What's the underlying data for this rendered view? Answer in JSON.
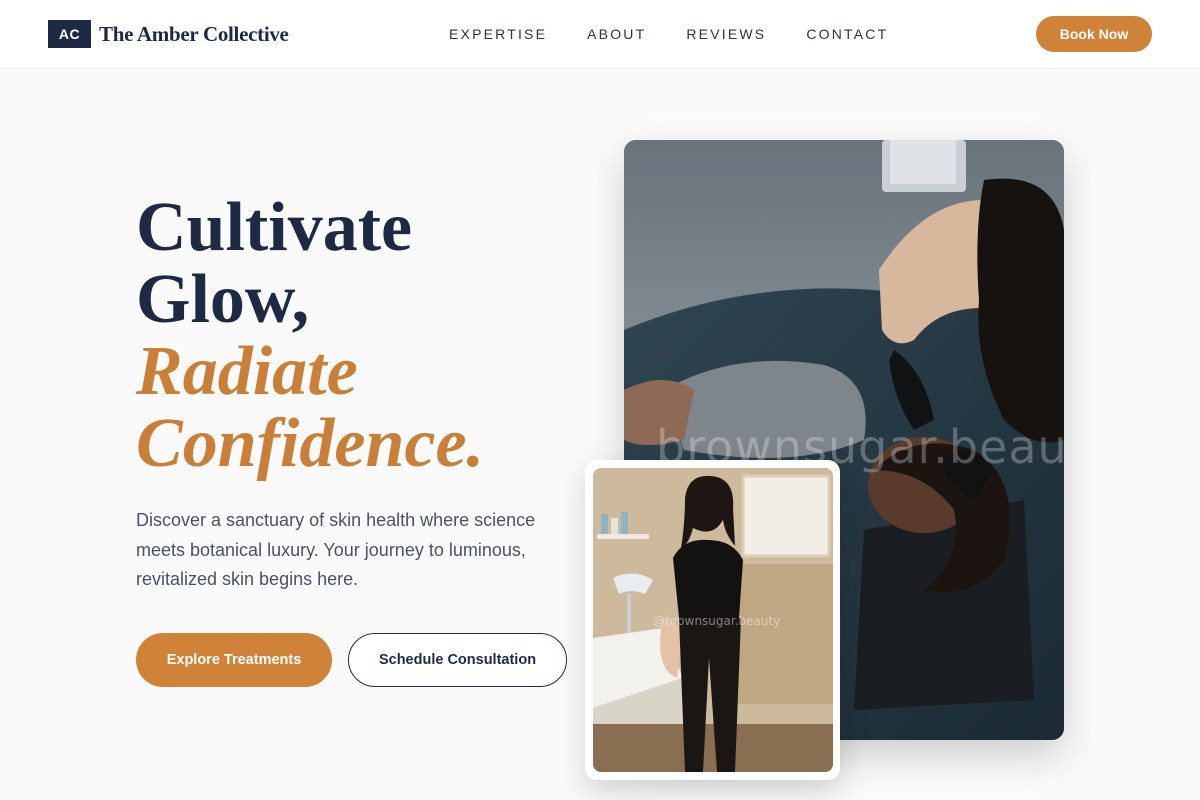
{
  "brand": {
    "mark": "AC",
    "name": "The Amber Collective"
  },
  "nav": {
    "items": [
      "EXPERTISE",
      "ABOUT",
      "REVIEWS",
      "CONTACT"
    ]
  },
  "header": {
    "cta_label": "Book Now"
  },
  "hero": {
    "headline_line1": "Cultivate",
    "headline_line2": "Glow,",
    "headline_accent_line1": "Radiate",
    "headline_accent_line2": "Confidence.",
    "description": "Discover a sanctuary of skin health where science meets botanical luxury. Your journey to luminous, revitalized skin begins here.",
    "primary_cta": "Explore Treatments",
    "secondary_cta": "Schedule Consultation"
  },
  "images": {
    "main_watermark": "brownsugar.beauty",
    "inset_watermark": "@brownsugar.beauty"
  },
  "colors": {
    "accent": "#d08238",
    "navy": "#1e2a44",
    "background": "#fafafa",
    "body_text": "#4a5266"
  }
}
